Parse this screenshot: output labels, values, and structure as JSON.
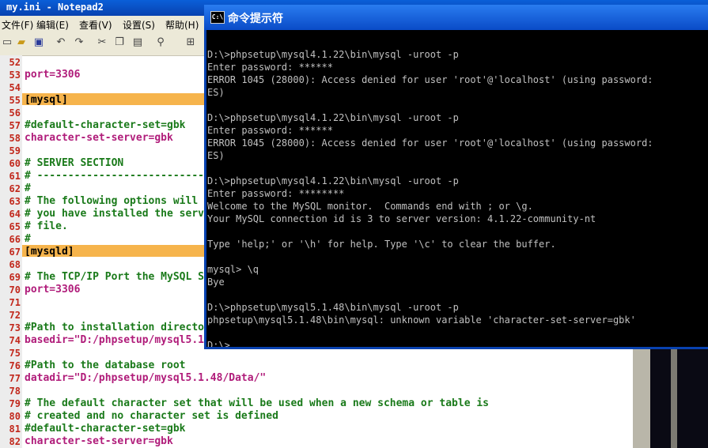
{
  "notepad": {
    "title": "my.ini - Notepad2",
    "menu": [
      "文件(F)",
      "编辑(E)",
      "查看(V)",
      "设置(S)",
      "帮助(H)"
    ],
    "lines": [
      {
        "n": "52",
        "t": ""
      },
      {
        "n": "53",
        "t": "port=3306"
      },
      {
        "n": "54",
        "t": ""
      },
      {
        "n": "55",
        "t": "[mysql]"
      },
      {
        "n": "56",
        "t": ""
      },
      {
        "n": "57",
        "t": "#default-character-set=gbk"
      },
      {
        "n": "58",
        "t": "character-set-server=gbk"
      },
      {
        "n": "59",
        "t": ""
      },
      {
        "n": "60",
        "t": "# SERVER SECTION"
      },
      {
        "n": "61",
        "t": "# -----------------------------"
      },
      {
        "n": "62",
        "t": "#"
      },
      {
        "n": "63",
        "t": "# The following options will"
      },
      {
        "n": "64",
        "t": "# you have installed the serv"
      },
      {
        "n": "65",
        "t": "# file."
      },
      {
        "n": "66",
        "t": "#"
      },
      {
        "n": "67",
        "t": "[mysqld]"
      },
      {
        "n": "68",
        "t": ""
      },
      {
        "n": "69",
        "t": "# The TCP/IP Port the MySQL S"
      },
      {
        "n": "70",
        "t": "port=3306"
      },
      {
        "n": "71",
        "t": ""
      },
      {
        "n": "72",
        "t": ""
      },
      {
        "n": "73",
        "t": "#Path to installation directo"
      },
      {
        "n": "74",
        "t": "basedir=\"D:/phpsetup/mysql5.1"
      },
      {
        "n": "75",
        "t": ""
      },
      {
        "n": "76",
        "t": "#Path to the database root"
      },
      {
        "n": "77",
        "t": "datadir=\"D:/phpsetup/mysql5.1.48/Data/\""
      },
      {
        "n": "78",
        "t": ""
      },
      {
        "n": "79",
        "t": "# The default character set that will be used when a new schema or table is"
      },
      {
        "n": "80",
        "t": "# created and no character set is defined"
      },
      {
        "n": "81",
        "t": "#default-character-set=gbk"
      },
      {
        "n": "82",
        "t": "character-set-server=gbk"
      }
    ]
  },
  "cmd": {
    "title": "命令提示符",
    "lines": [
      "",
      "D:\\>phpsetup\\mysql4.1.22\\bin\\mysql -uroot -p",
      "Enter password: ******",
      "ERROR 1045 (28000): Access denied for user 'root'@'localhost' (using password:",
      "ES)",
      "",
      "D:\\>phpsetup\\mysql4.1.22\\bin\\mysql -uroot -p",
      "Enter password: ******",
      "ERROR 1045 (28000): Access denied for user 'root'@'localhost' (using password:",
      "ES)",
      "",
      "D:\\>phpsetup\\mysql4.1.22\\bin\\mysql -uroot -p",
      "Enter password: ********",
      "Welcome to the MySQL monitor.  Commands end with ; or \\g.",
      "Your MySQL connection id is 3 to server version: 4.1.22-community-nt",
      "",
      "Type 'help;' or '\\h' for help. Type '\\c' to clear the buffer.",
      "",
      "mysql> \\q",
      "Bye",
      "",
      "D:\\>phpsetup\\mysql5.1.48\\bin\\mysql -uroot -p",
      "phpsetup\\mysql5.1.48\\bin\\mysql: unknown variable 'character-set-server=gbk'",
      "",
      "D:\\>"
    ]
  }
}
